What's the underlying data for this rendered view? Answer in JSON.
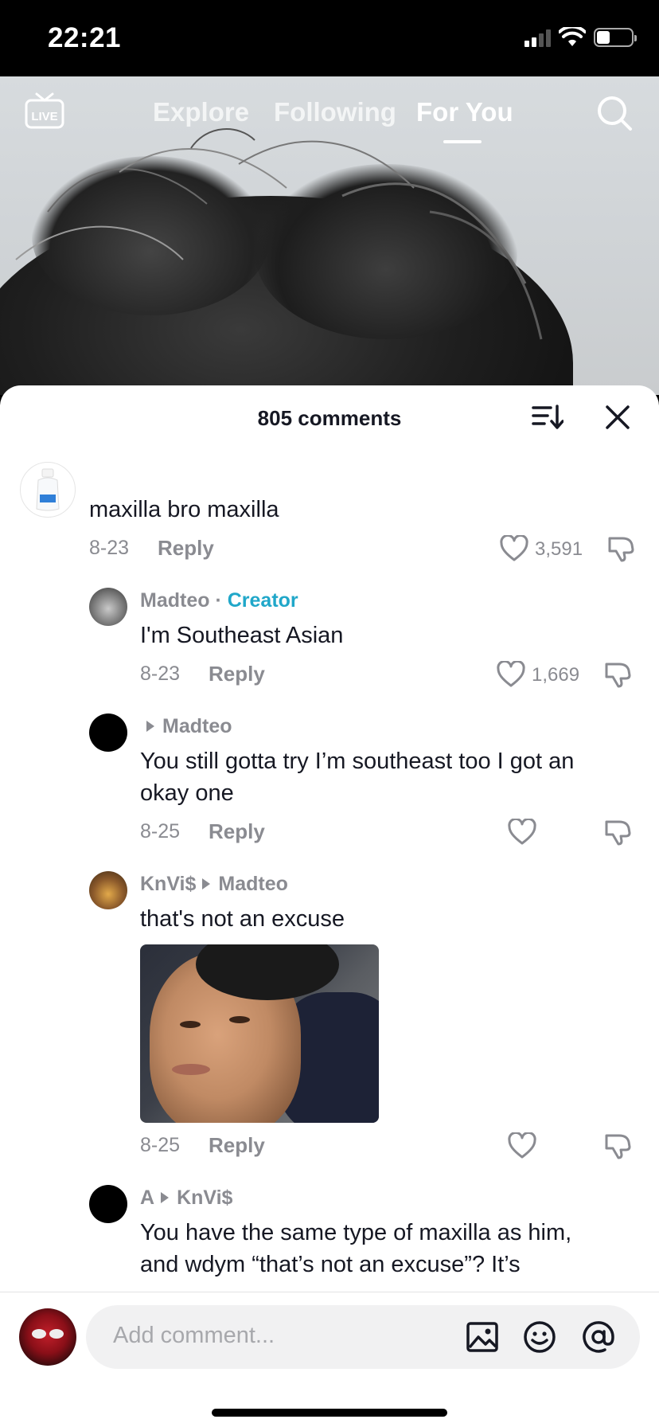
{
  "status_bar": {
    "time": "22:21"
  },
  "top_nav": {
    "live_label": "LIVE",
    "tabs": [
      {
        "label": "Explore"
      },
      {
        "label": "Following"
      },
      {
        "label": "For You"
      }
    ],
    "active_tab": "For You"
  },
  "comments_panel": {
    "count_label": "805 comments",
    "comments": [
      {
        "text": "maxilla bro maxilla",
        "date": "8-23",
        "reply_label": "Reply",
        "likes": "3,591"
      },
      {
        "username": "Madteo",
        "separator": "·",
        "badge": "Creator",
        "text": "I'm Southeast Asian",
        "date": "8-23",
        "reply_label": "Reply",
        "likes": "1,669"
      },
      {
        "reply_to": "Madteo",
        "text_line1": "You still gotta try I’m southeast too I got an",
        "text_line2": "okay one",
        "date": "8-25",
        "reply_label": "Reply"
      },
      {
        "username": "KnVi$",
        "reply_to": "Madteo",
        "text": "that's not an excuse",
        "date": "8-25",
        "reply_label": "Reply"
      },
      {
        "username": "A",
        "reply_to": "KnVi$",
        "text_line1": "You have the same type of maxilla as him,",
        "text_line2": "and wdym “that’s not an excuse”? It’s"
      }
    ]
  },
  "bottom_bar": {
    "placeholder": "Add comment..."
  },
  "colors": {
    "creator_badge": "#20a7c9",
    "muted_text": "#8a8b91",
    "primary_text": "#161823"
  }
}
